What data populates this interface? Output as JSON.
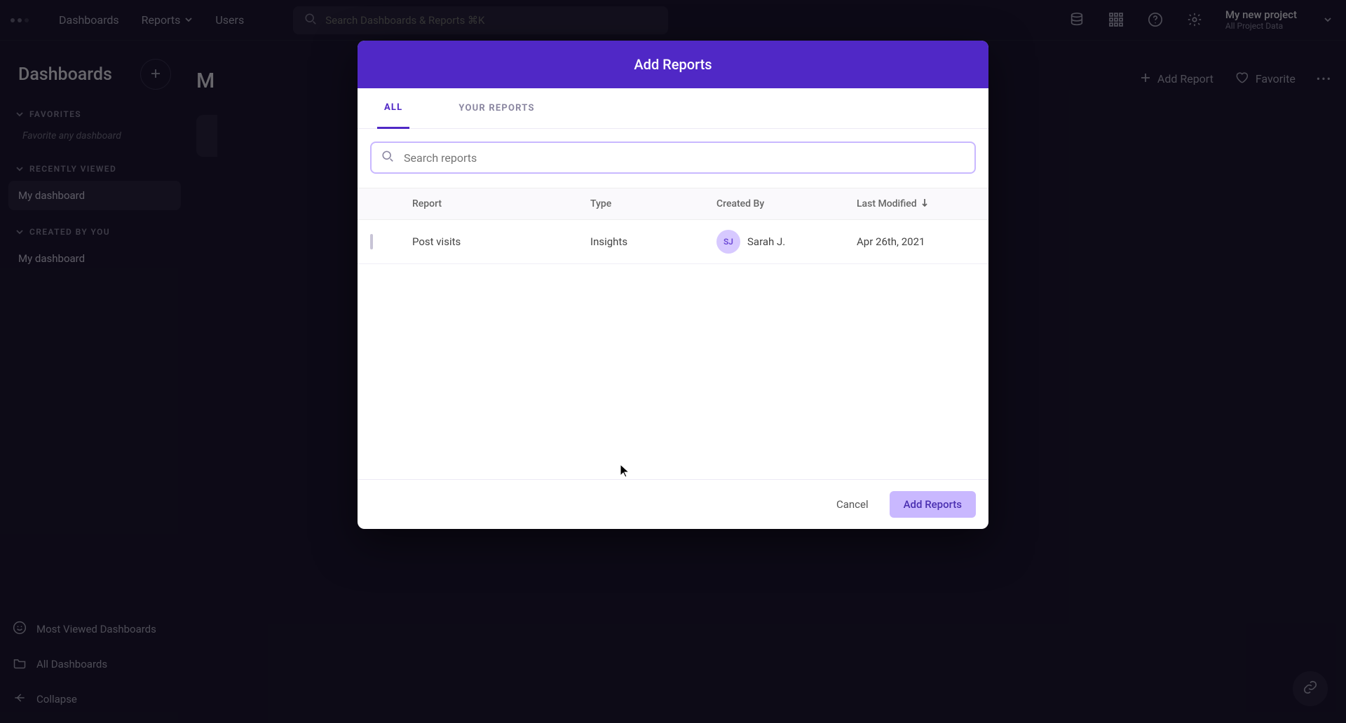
{
  "header": {
    "nav": {
      "dashboards": "Dashboards",
      "reports": "Reports",
      "users": "Users"
    },
    "search_placeholder": "Search Dashboards & Reports ⌘K",
    "project": {
      "name": "My new project",
      "subtitle": "All Project Data"
    }
  },
  "sidebar": {
    "title": "Dashboards",
    "favorites_label": "FAVORITES",
    "favorites_hint": "Favorite any dashboard",
    "recently_label": "RECENTLY VIEWED",
    "recently_item": "My dashboard",
    "created_label": "CREATED BY YOU",
    "created_item": "My dashboard",
    "bottom": {
      "most_viewed": "Most Viewed Dashboards",
      "all_dash": "All Dashboards",
      "collapse": "Collapse"
    }
  },
  "main": {
    "title_clip": "M",
    "add_report": "Add Report",
    "favorite": "Favorite"
  },
  "modal": {
    "title": "Add Reports",
    "tabs": {
      "all": "ALL",
      "your": "YOUR REPORTS"
    },
    "search_placeholder": "Search reports",
    "columns": {
      "report": "Report",
      "type": "Type",
      "created_by": "Created By",
      "last_modified": "Last Modified"
    },
    "rows": [
      {
        "report": "Post visits",
        "type": "Insights",
        "creator_initials": "SJ",
        "creator_name": "Sarah J.",
        "last_modified": "Apr 26th, 2021"
      }
    ],
    "cancel": "Cancel",
    "confirm": "Add Reports"
  }
}
